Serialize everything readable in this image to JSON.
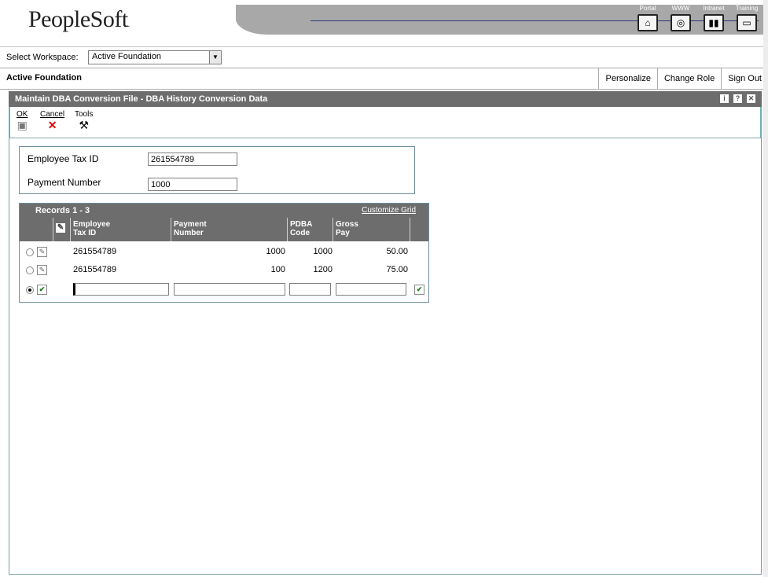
{
  "brand": {
    "logo_text": "PeopleSoft",
    "logo_suffix": "."
  },
  "nav": {
    "items": [
      {
        "label": "Portal",
        "icon": "home-icon"
      },
      {
        "label": "WWW",
        "icon": "globe-icon"
      },
      {
        "label": "Intranet",
        "icon": "book-icon"
      },
      {
        "label": "Training",
        "icon": "monitor-icon"
      }
    ]
  },
  "workspace": {
    "label": "Select Workspace:",
    "selected": "Active Foundation"
  },
  "rolebar": {
    "title": "Active Foundation",
    "personalize": "Personalize",
    "change_role": "Change Role",
    "sign_out": "Sign Out"
  },
  "form": {
    "title": "Maintain DBA Conversion File - DBA History Conversion Data",
    "toolbar": {
      "ok": "OK",
      "cancel": "Cancel",
      "tools": "Tools"
    },
    "fields": {
      "employee_tax_id_label": "Employee Tax ID",
      "employee_tax_id_value": "261554789",
      "payment_number_label": "Payment Number",
      "payment_number_value": "1000"
    }
  },
  "grid": {
    "title": "Records 1 - 3",
    "customize": "Customize Grid",
    "columns": {
      "employee_tax_id_1": "Employee",
      "employee_tax_id_2": "Tax ID",
      "payment_number_1": "Payment",
      "payment_number_2": "Number",
      "pdba_code_1": "PDBA",
      "pdba_code_2": "Code",
      "gross_pay_1": "Gross",
      "gross_pay_2": "Pay"
    },
    "rows": [
      {
        "employee_tax_id": "261554789",
        "payment_number": "1000",
        "pdba_code": "1000",
        "gross_pay": "50.00"
      },
      {
        "employee_tax_id": "261554789",
        "payment_number": "100",
        "pdba_code": "1200",
        "gross_pay": "75.00"
      }
    ]
  }
}
